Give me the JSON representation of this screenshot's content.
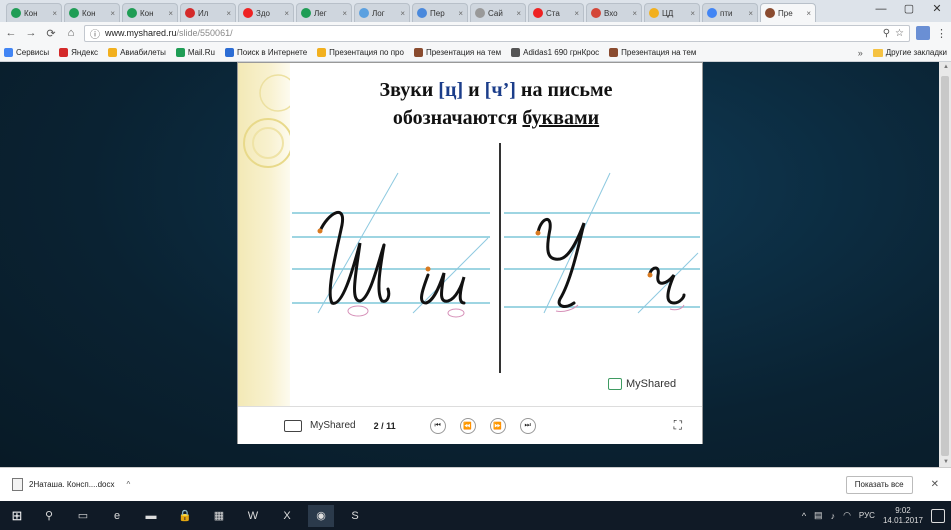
{
  "browser": {
    "tabs": [
      {
        "label": "Кон",
        "icon_color": "#1f9d55"
      },
      {
        "label": "Кон",
        "icon_color": "#1f9d55"
      },
      {
        "label": "Кон",
        "icon_color": "#1f9d55"
      },
      {
        "label": "Ил",
        "icon_color": "#d42a2a"
      },
      {
        "label": "Здо",
        "icon_color": "#e22"
      },
      {
        "label": "Лег",
        "icon_color": "#1f9d55"
      },
      {
        "label": "Лог",
        "icon_color": "#5aa0e0"
      },
      {
        "label": "Пер",
        "icon_color": "#4a89dc"
      },
      {
        "label": "Сай",
        "icon_color": "#999999"
      },
      {
        "label": "Ста",
        "icon_color": "#e22"
      },
      {
        "label": "Вхо",
        "icon_color": "#d44638"
      },
      {
        "label": "ЦД",
        "icon_color": "#f2b01e"
      },
      {
        "label": "пти",
        "icon_color": "#4285f4"
      },
      {
        "label": "Пре",
        "icon_color": "#8a4b2f",
        "active": true
      }
    ],
    "window_controls": [
      "—",
      "▢",
      "✕"
    ],
    "url_host": "www.myshared.ru",
    "url_path": "/slide/550061/",
    "bookmarks": [
      {
        "label": "Сервисы",
        "icon_color": "#4285f4"
      },
      {
        "label": "Яндекс",
        "icon_color": "#d42a2a"
      },
      {
        "label": "Авиабилеты",
        "icon_color": "#f2b01e"
      },
      {
        "label": "Mail.Ru",
        "icon_color": "#1f9d55"
      },
      {
        "label": "Поиск в Интернете",
        "icon_color": "#2b6cd4"
      },
      {
        "label": "Презентация по про",
        "icon_color": "#f2b01e"
      },
      {
        "label": "Презентация на тем",
        "icon_color": "#8a4b2f"
      },
      {
        "label": "Adidas1 690 грнКрос",
        "icon_color": "#555555"
      },
      {
        "label": "Презентация на тем",
        "icon_color": "#8a4b2f"
      }
    ],
    "bookmarks_more": "»",
    "other_bookmarks": "Другие закладки"
  },
  "slide": {
    "title_line1_a": "Звуки ",
    "title_bracket1": "[ц]",
    "title_line1_b": " и ",
    "title_bracket2": "[ч’]",
    "title_line1_c": " на письме",
    "title_line2_a": "обозначаются ",
    "title_line2_u": "буквами",
    "brand": "MyShared"
  },
  "player": {
    "brand": "MyShared",
    "page_indicator": "2 / 11",
    "buttons": [
      "⏮",
      "⏪",
      "⏩",
      "⏭"
    ],
    "fullscreen": "⛶"
  },
  "downloads": {
    "file_label": "2Наташа. Консп....docx",
    "caret": "^",
    "show_all": "Показать все",
    "close": "✕"
  },
  "taskbar": {
    "start": "⊞",
    "items": [
      "⚲",
      "▭",
      "e",
      "▬",
      "🔒",
      "▦",
      "W",
      "X",
      "◉",
      "S"
    ],
    "lang": "РУС",
    "time": "9:02",
    "date": "14.01.2017"
  }
}
